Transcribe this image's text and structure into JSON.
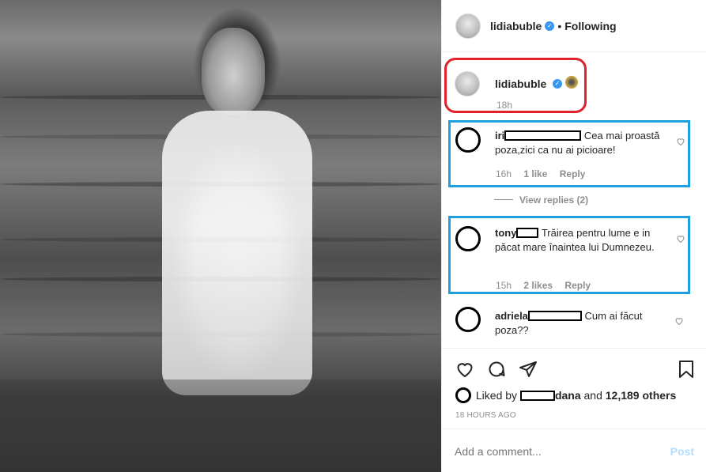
{
  "header": {
    "username": "lidiabuble",
    "separator": "•",
    "follow_status": "Following"
  },
  "caption": {
    "username": "lidiabuble",
    "time": "18h"
  },
  "comments": [
    {
      "username": "iri",
      "text": "Cea mai proastă poza,zici ca nu ai picioare!",
      "time": "16h",
      "likes": "1 like",
      "reply": "Reply"
    },
    {
      "username": "tony",
      "text": "Trăirea pentru lume e in păcat mare înaintea lui Dumnezeu.",
      "time": "15h",
      "likes": "2 likes",
      "reply": "Reply"
    },
    {
      "username": "adriela",
      "text": "Cum ai făcut poza??"
    }
  ],
  "view_replies": "View replies (2)",
  "likes": {
    "prefix": "Liked by",
    "user": "dana",
    "and": "and",
    "count": "12,189 others"
  },
  "post_time": "18 HOURS AGO",
  "add_comment": {
    "placeholder": "Add a comment...",
    "post_label": "Post"
  },
  "colors": {
    "verified": "#3897f0",
    "red_highlight": "#e0202a",
    "blue_highlight": "#1fa1e0",
    "post_disabled": "#b2dffc"
  },
  "icons": [
    "heart-icon",
    "comment-icon",
    "share-icon",
    "bookmark-icon",
    "verified-icon"
  ]
}
